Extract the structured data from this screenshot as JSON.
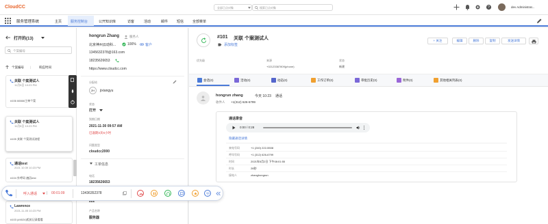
{
  "app": {
    "logo": "CloudCC"
  },
  "topbar": {
    "search_scope": "全部已点对象",
    "search_placeholder": "搜索已点对象",
    "user": "dev Administrat..."
  },
  "nav": {
    "app_name": "服务管理系统",
    "items": [
      "主页",
      "服务控制台",
      "公开知识库",
      "访客",
      "活动",
      "邮件",
      "短信",
      "全部菜单"
    ]
  },
  "list": {
    "title": "打开的(13)",
    "search_placeholder": "个案编号",
    "sort1": "个案编号",
    "sort2": "响应时间",
    "cards": [
      {
        "title": "关联 个案测试人",
        "meta": "11月5日 10:23 PM",
        "desc": "#106 66666工单个案"
      },
      {
        "title": "关联 个案测试人",
        "meta": "11月5日 10:23 PM",
        "desc": "#105 关联 个案测试流程"
      },
      {
        "title": "通话test",
        "meta": "2021 10:39 10:23 PM",
        "desc": "#104 外呼码 遍历test"
      },
      {
        "title": "Lawrence",
        "meta": "2021-11-05 10:23 PM",
        "desc": "#103 (#4024)相关记录看看"
      }
    ]
  },
  "contact": {
    "name": "hongrun Zhang",
    "tag": "服务人",
    "company": "北京神州云动科...",
    "progress": "100%",
    "progress_link": "客户",
    "email": "1345632378@163.com",
    "phone": "18235626653",
    "url": "https://www.cloudcc.com",
    "assigned_label": "分配给",
    "assignee_initials": "ZH",
    "assignee": "jixiangyu",
    "status_label": "状态",
    "status": "打开",
    "deadline_label": "到期日期",
    "deadline": "2021-11-30 09:57 AM",
    "overdue": "已逾期4天6小时",
    "type_label": "问题类型",
    "type_val": "cloudcc2000",
    "section": "工单信息",
    "phone_label": "电话",
    "phone2": "18235626653",
    "field1": "13436352378",
    "field2": "222",
    "product_label": "产品名称",
    "product": "服务器"
  },
  "case": {
    "number": "#101",
    "title": "关联 个案测试人",
    "add_tag": "添加标签",
    "buttons": [
      "+ 关注",
      "编辑",
      "删除",
      "复制",
      "发送详情"
    ],
    "info": [
      {
        "label": "优先级",
        "value": ""
      },
      {
        "label": "来源",
        "value": "+02123387809(phone)"
      },
      {
        "label": "状态",
        "value": "新建"
      }
    ],
    "tabs": [
      "会话(0)",
      "活动(0)",
      "动态(0)",
      "工作订单(0)",
      "审批历史(0)",
      "附件(0)",
      "其他相关列表(0)"
    ]
  },
  "activity": {
    "author": "hongrun zhang",
    "time": "今天 10:23",
    "type": "通话",
    "to_label": "收件人",
    "to": "+1(312) 626-6799",
    "recording_title": "通话录音",
    "player_time": "0:00 / 0:28",
    "hide_link": "隐藏通话详情",
    "details": [
      {
        "label": "来电号码",
        "value": "+1 (240) 222-5508"
      },
      {
        "label": "呼叫号码",
        "value": "+1 (312) 626-6799"
      },
      {
        "label": "时间",
        "value": "2021年5月2日 下午08:01:55"
      },
      {
        "label": "时长",
        "value": "28秒"
      },
      {
        "label": "接电人",
        "value": "zhanghongrun"
      }
    ]
  },
  "callbar": {
    "status": "呼入通话",
    "timer": "00:01:09",
    "number": "13436352378"
  },
  "colors": {
    "accent": "#4a7ad8",
    "brand": "#e8642a",
    "danger": "#e04848",
    "success": "#2fb553"
  }
}
